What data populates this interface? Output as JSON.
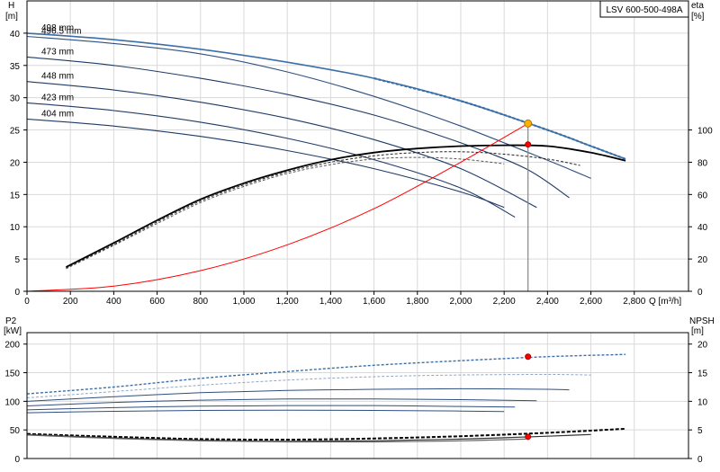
{
  "chart_data": [
    {
      "type": "line",
      "title": "LSV 600-500-498A",
      "xlabel": "Q [m³/h]",
      "ylabel_left_name": "H",
      "ylabel_left_unit": "[m]",
      "ylabel_right_name": "eta",
      "ylabel_right_unit": "[%]",
      "xlim": [
        0,
        3050
      ],
      "ylim_left": [
        0,
        45
      ],
      "ylim_right": [
        0,
        180
      ],
      "grid": true,
      "x_ticks": [
        "0",
        "200",
        "400",
        "600",
        "800",
        "1,000",
        "1,200",
        "1,400",
        "1,600",
        "1,800",
        "2,000",
        "2,200",
        "2,400",
        "2,600",
        "2,800"
      ],
      "y_left_ticks": [
        "0",
        "5",
        "10",
        "15",
        "20",
        "25",
        "30",
        "35",
        "40"
      ],
      "y_right_ticks": [
        "0",
        "20",
        "40",
        "60",
        "80",
        "100"
      ],
      "head_curves": [
        {
          "name": "498 mm",
          "color": "#3b6fa8",
          "points": [
            [
              0,
              40
            ],
            [
              400,
              39
            ],
            [
              800,
              37.5
            ],
            [
              1200,
              35.5
            ],
            [
              1600,
              33
            ],
            [
              2000,
              29.5
            ],
            [
              2400,
              25
            ],
            [
              2600,
              22.5
            ],
            [
              2760,
              20.5
            ]
          ]
        },
        {
          "name": "496.5 mm",
          "color": "#2f4f7f",
          "points": [
            [
              0,
              39.5
            ],
            [
              400,
              38.4
            ],
            [
              800,
              36.8
            ],
            [
              1200,
              34
            ],
            [
              1600,
              30.2
            ],
            [
              2000,
              25.6
            ],
            [
              2400,
              20.3
            ],
            [
              2600,
              17.5
            ]
          ]
        },
        {
          "name": "473 mm",
          "color": "#1f3a66",
          "points": [
            [
              0,
              36.3
            ],
            [
              400,
              35
            ],
            [
              800,
              33
            ],
            [
              1200,
              30.5
            ],
            [
              1600,
              27.3
            ],
            [
              2000,
              23
            ],
            [
              2300,
              19
            ],
            [
              2500,
              14.5
            ]
          ]
        },
        {
          "name": "448 mm",
          "color": "#1f3a66",
          "points": [
            [
              0,
              32.5
            ],
            [
              400,
              31.2
            ],
            [
              800,
              29.3
            ],
            [
              1200,
              26.8
            ],
            [
              1600,
              23.5
            ],
            [
              2000,
              19
            ],
            [
              2350,
              13
            ]
          ]
        },
        {
          "name": "423 mm",
          "color": "#1f3a66",
          "points": [
            [
              0,
              29.2
            ],
            [
              400,
              28
            ],
            [
              800,
              26.2
            ],
            [
              1200,
              23.7
            ],
            [
              1600,
              20.4
            ],
            [
              2000,
              16
            ],
            [
              2250,
              11.5
            ]
          ]
        },
        {
          "name": "404 mm",
          "color": "#1f3a66",
          "points": [
            [
              0,
              26.7
            ],
            [
              400,
              25.6
            ],
            [
              800,
              24
            ],
            [
              1200,
              21.8
            ],
            [
              1600,
              19
            ],
            [
              2000,
              15.4
            ],
            [
              2200,
              13
            ]
          ]
        }
      ],
      "efficiency_curves": [
        {
          "name": "",
          "color": "#000000",
          "points": [
            [
              180,
              15
            ],
            [
              400,
              30
            ],
            [
              600,
              44
            ],
            [
              800,
              57
            ],
            [
              1000,
              67
            ],
            [
              1200,
              75
            ],
            [
              1400,
              81.5
            ],
            [
              1600,
              86
            ],
            [
              1800,
              88.5
            ],
            [
              2000,
              90
            ],
            [
              2200,
              90.5
            ],
            [
              2400,
              90
            ],
            [
              2600,
              86
            ],
            [
              2760,
              81
            ]
          ]
        },
        {
          "name": "",
          "color": "#222222",
          "points": [
            [
              180,
              14.5
            ],
            [
              400,
              29
            ],
            [
              600,
              43
            ],
            [
              800,
              56
            ],
            [
              1000,
              66
            ],
            [
              1200,
              74
            ],
            [
              1400,
              80
            ],
            [
              1600,
              84
            ],
            [
              1800,
              86
            ],
            [
              2000,
              86.5
            ],
            [
              2200,
              85
            ],
            [
              2400,
              82
            ],
            [
              2550,
              78
            ]
          ]
        },
        {
          "name": "",
          "color": "#555555",
          "points": [
            [
              180,
              14
            ],
            [
              400,
              28.5
            ],
            [
              600,
              42
            ],
            [
              800,
              55
            ],
            [
              1000,
              65
            ],
            [
              1200,
              73
            ],
            [
              1400,
              78.5
            ],
            [
              1600,
              82
            ],
            [
              1800,
              83
            ],
            [
              2000,
              82
            ],
            [
              2200,
              79
            ]
          ]
        }
      ],
      "system_curve": {
        "color": "#ff0000",
        "points": [
          [
            0,
            0
          ],
          [
            400,
            0.8
          ],
          [
            800,
            3.2
          ],
          [
            1200,
            7.2
          ],
          [
            1600,
            12.8
          ],
          [
            2000,
            20
          ],
          [
            2310,
            26
          ]
        ]
      },
      "operating_points": [
        {
          "x": 2310,
          "y": 26,
          "axis": "left",
          "color": "#ffb000"
        },
        {
          "x": 2310,
          "y": 91,
          "axis": "right",
          "color": "#ff0000"
        }
      ],
      "duty_line_x": 2310
    },
    {
      "type": "line",
      "ylabel_left_name": "P2",
      "ylabel_left_unit": "[kW]",
      "ylabel_right_name": "NPSH",
      "ylabel_right_unit": "[m]",
      "xlim": [
        0,
        3050
      ],
      "ylim_left": [
        0,
        220
      ],
      "ylim_right": [
        0,
        22
      ],
      "grid": true,
      "y_left_ticks": [
        "0",
        "50",
        "100",
        "150",
        "200"
      ],
      "y_right_ticks": [
        "0",
        "5",
        "10",
        "15",
        "20"
      ],
      "power_curves": [
        {
          "name": "",
          "color": "#3b6fa8",
          "points": [
            [
              0,
              113
            ],
            [
              400,
              125
            ],
            [
              800,
              140
            ],
            [
              1200,
              152
            ],
            [
              1600,
              163
            ],
            [
              2000,
              171
            ],
            [
              2400,
              178
            ],
            [
              2760,
              182
            ]
          ]
        },
        {
          "name": "",
          "color": "#8fa7c4",
          "points": [
            [
              0,
              106
            ],
            [
              400,
              117
            ],
            [
              800,
              128
            ],
            [
              1200,
              137
            ],
            [
              1600,
              143
            ],
            [
              2000,
              146
            ],
            [
              2400,
              147
            ],
            [
              2600,
              146
            ]
          ]
        },
        {
          "name": "",
          "color": "#2f4f7f",
          "points": [
            [
              0,
              100
            ],
            [
              400,
              108
            ],
            [
              800,
              115
            ],
            [
              1200,
              119
            ],
            [
              1600,
              121
            ],
            [
              2000,
              122
            ],
            [
              2400,
              121
            ],
            [
              2500,
              120
            ]
          ]
        },
        {
          "name": "",
          "color": "#2f4f7f",
          "points": [
            [
              0,
              92
            ],
            [
              400,
              98
            ],
            [
              800,
              102
            ],
            [
              1200,
              104
            ],
            [
              1600,
              104
            ],
            [
              2000,
              103
            ],
            [
              2350,
              101
            ]
          ]
        },
        {
          "name": "",
          "color": "#2f4f7f",
          "points": [
            [
              0,
              85
            ],
            [
              400,
              89
            ],
            [
              800,
              91.5
            ],
            [
              1200,
              92.5
            ],
            [
              1600,
              92.5
            ],
            [
              2000,
              91
            ],
            [
              2250,
              90
            ]
          ]
        },
        {
          "name": "",
          "color": "#2f4f7f",
          "points": [
            [
              0,
              80
            ],
            [
              400,
              82.5
            ],
            [
              800,
              84
            ],
            [
              1200,
              84.5
            ],
            [
              1600,
              84
            ],
            [
              2000,
              83
            ],
            [
              2200,
              82
            ]
          ]
        }
      ],
      "npsh_curves": [
        {
          "name": "",
          "color": "#000000",
          "points": [
            [
              0,
              4.3
            ],
            [
              400,
              3.8
            ],
            [
              800,
              3.4
            ],
            [
              1200,
              3.3
            ],
            [
              1600,
              3.5
            ],
            [
              2000,
              3.9
            ],
            [
              2400,
              4.5
            ],
            [
              2760,
              5.2
            ]
          ]
        },
        {
          "name": "",
          "color": "#333333",
          "points": [
            [
              0,
              4.2
            ],
            [
              400,
              3.6
            ],
            [
              800,
              3.2
            ],
            [
              1200,
              3.0
            ],
            [
              1600,
              3.1
            ],
            [
              2000,
              3.4
            ],
            [
              2400,
              3.9
            ],
            [
              2600,
              4.2
            ]
          ]
        },
        {
          "name": "",
          "color": "#666666",
          "points": [
            [
              0,
              4.1
            ],
            [
              400,
              3.5
            ],
            [
              800,
              3.1
            ],
            [
              1200,
              2.9
            ],
            [
              1600,
              2.9
            ],
            [
              2000,
              3.1
            ],
            [
              2300,
              3.4
            ]
          ]
        }
      ],
      "operating_points": [
        {
          "x": 2310,
          "y": 178,
          "axis": "left",
          "color": "#ff0000"
        },
        {
          "x": 2310,
          "y": 3.8,
          "axis": "right",
          "color": "#ff0000"
        }
      ]
    }
  ]
}
